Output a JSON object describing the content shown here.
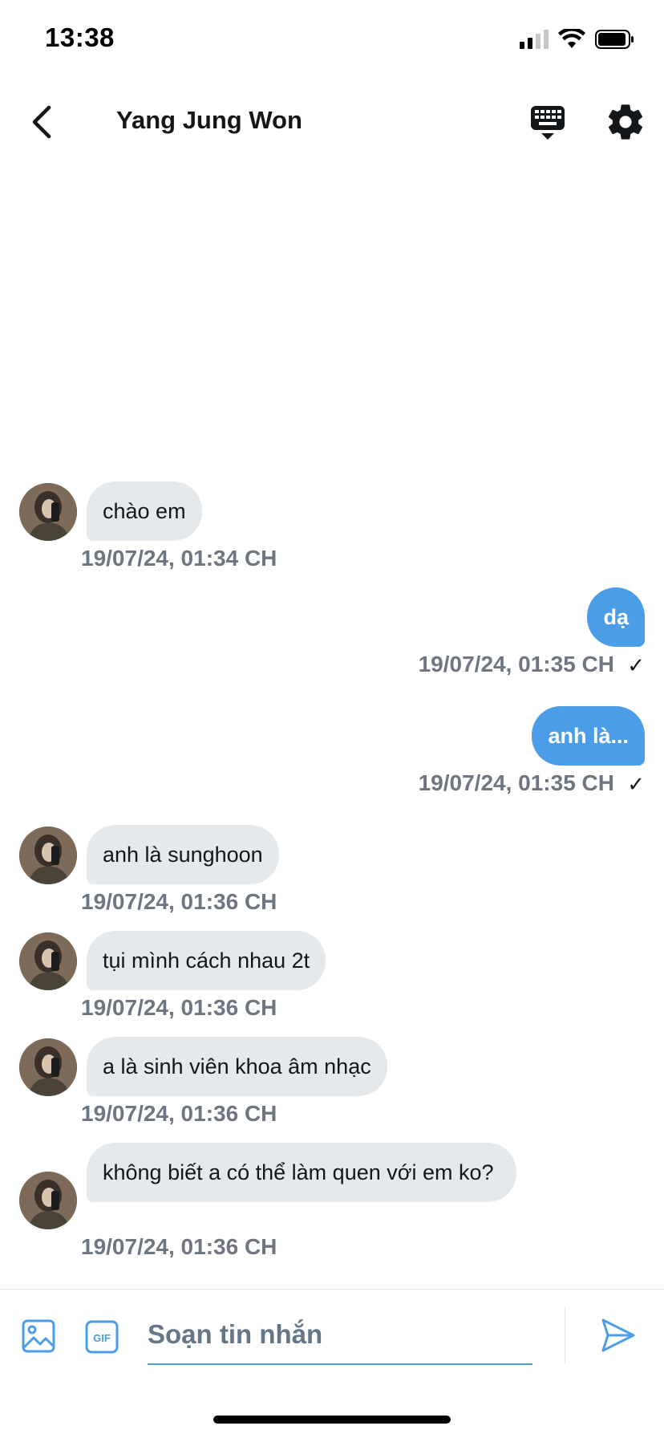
{
  "status_bar": {
    "time": "13:38",
    "icons": [
      "cellular-signal-icon",
      "wifi-icon",
      "battery-icon"
    ]
  },
  "header": {
    "title": "Yang Jung Won",
    "icons": [
      "back-chevron-icon",
      "keyboard-icon",
      "gear-icon"
    ]
  },
  "colors": {
    "accent": "#4a9de6",
    "incoming_bubble": "#e6e9ec",
    "timestamp": "#6e7681"
  },
  "messages": [
    {
      "direction": "incoming",
      "text": "chào em",
      "time": "19/07/24, 01:34 CH"
    },
    {
      "direction": "outgoing",
      "text": "dạ",
      "time": "19/07/24, 01:35 CH",
      "status_icon": "✓"
    },
    {
      "direction": "outgoing",
      "text": "anh là...",
      "time": "19/07/24, 01:35 CH",
      "status_icon": "✓"
    },
    {
      "direction": "incoming",
      "text": "anh là sunghoon",
      "time": "19/07/24, 01:36 CH"
    },
    {
      "direction": "incoming",
      "text": "tụi mình cách nhau 2t",
      "time": "19/07/24, 01:36 CH"
    },
    {
      "direction": "incoming",
      "text": "a là sinh viên khoa âm nhạc",
      "time": "19/07/24, 01:36 CH"
    },
    {
      "direction": "incoming",
      "text": "không biết a có thể làm quen với em ko?",
      "time": "19/07/24, 01:36 CH"
    }
  ],
  "composer": {
    "placeholder": "Soạn tin nhắn",
    "gif_label": "GIF",
    "icons": [
      "image-icon",
      "gif-icon",
      "send-icon"
    ]
  }
}
